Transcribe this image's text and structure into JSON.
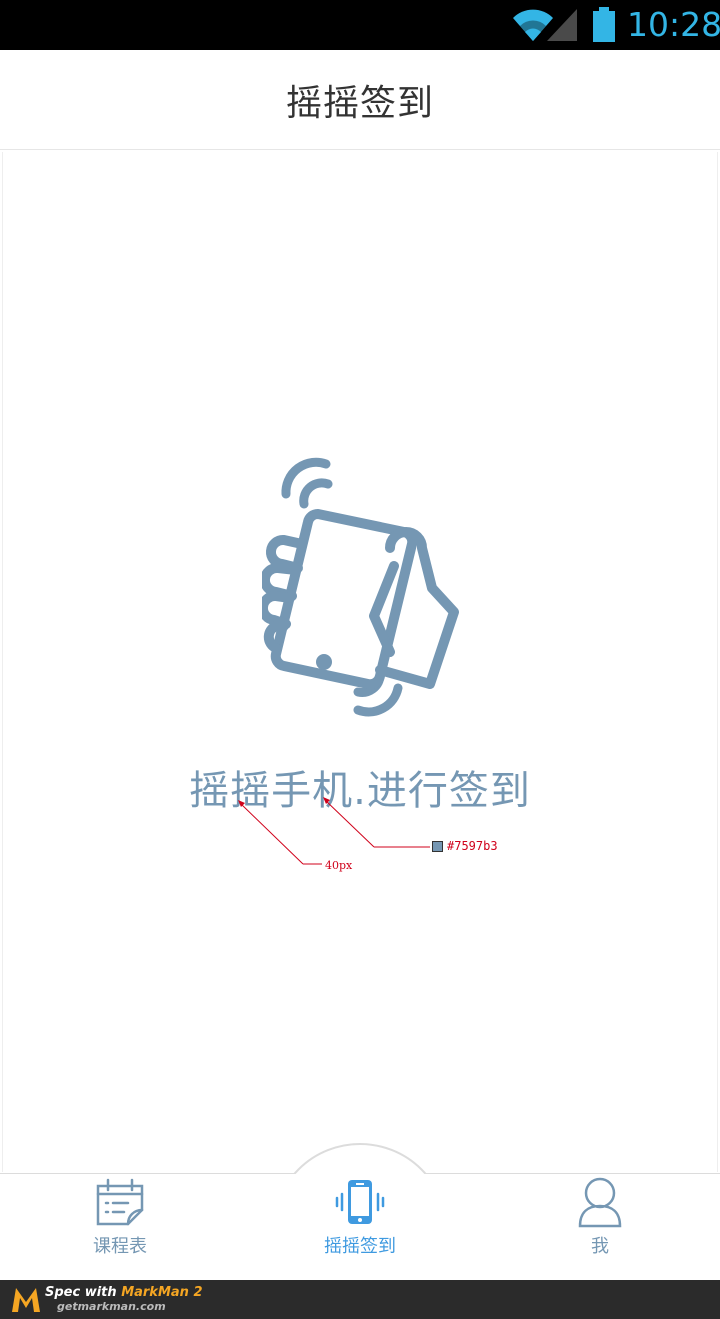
{
  "status_bar": {
    "time": "10:28",
    "icons": [
      "wifi-icon",
      "signal-icon",
      "battery-icon"
    ],
    "accent_color": "#33b5e5"
  },
  "header": {
    "title": "摇摇签到"
  },
  "main": {
    "illustration_icon": "shake-phone-hand-icon",
    "prompt": "摇摇手机.进行签到",
    "prompt_color": "#7597b3"
  },
  "annotations": {
    "font_size": "40px",
    "color": "#7597b3"
  },
  "tabbar": {
    "tabs": [
      {
        "label": "课程表",
        "icon": "calendar-icon",
        "active": false
      },
      {
        "label": "摇摇签到",
        "icon": "vibrating-phone-icon",
        "active": true
      },
      {
        "label": "我",
        "icon": "person-icon",
        "active": false
      }
    ],
    "active_color": "#3f9ae0",
    "inactive_color": "#7597b3"
  },
  "markman": {
    "spec_prefix": "Spec with ",
    "brand": "MarkMan 2",
    "url": "getmarkman.com"
  }
}
